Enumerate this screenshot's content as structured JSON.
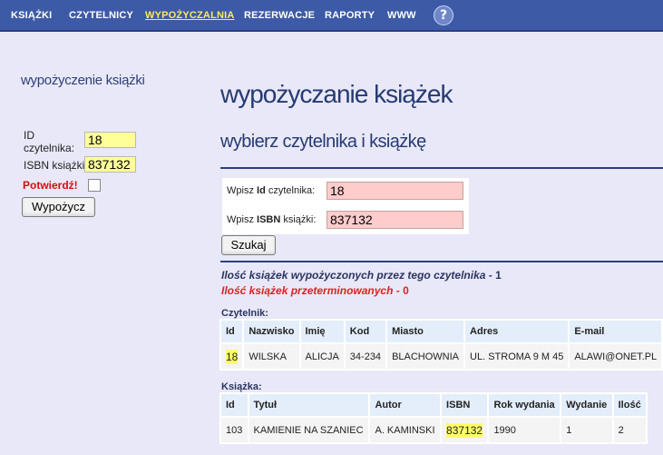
{
  "nav": {
    "items": [
      "KSIĄŻKI",
      "CZYTELNICY",
      "WYPOŻYCZALNIA",
      "REZERWACJE",
      "RAPORTY",
      "WWW"
    ],
    "help": "?"
  },
  "sidebar": {
    "title": "wypożyczenie książki",
    "id_label": "ID czytelnika:",
    "id_value": "18",
    "isbn_label": "ISBN książki:",
    "isbn_value": "837132",
    "confirm_label": "Potwierdź!",
    "button": "Wypożycz"
  },
  "main": {
    "title": "wypożyczanie książek",
    "subtitle": "wybierz czytelnika i książkę",
    "form": {
      "row1_pre": "Wpisz",
      "row1_strong": "Id",
      "row1_post": "czytelnika:",
      "row1_value": "18",
      "row2_pre": "Wpisz",
      "row2_strong": "ISBN",
      "row2_post": "książki:",
      "row2_value": "837132",
      "button": "Szukaj"
    },
    "borrowed_label": "Ilość książek wypożyczonych przez tego czytelnika",
    "borrowed_count": "1",
    "overdue_label": "Ilość książek przeterminowanych",
    "overdue_count": "0",
    "reader": {
      "title": "Czytelnik:",
      "headers": [
        "Id",
        "Nazwisko",
        "Imię",
        "Kod",
        "Miasto",
        "Adres",
        "E-mail"
      ],
      "row": [
        "18",
        "WILSKA",
        "ALICJA",
        "34-234",
        "BLACHOWNIA",
        "UL. STROMA 9 M 45",
        "ALAWI@ONET.PL"
      ]
    },
    "book": {
      "title": "Książka:",
      "headers": [
        "Id",
        "Tytuł",
        "Autor",
        "ISBN",
        "Rok wydania",
        "Wydanie",
        "Ilość"
      ],
      "row": [
        "103",
        "KAMIENIE NA SZANIEC",
        "A. KAMINSKI",
        "837132",
        "1990",
        "1",
        "2"
      ]
    }
  }
}
